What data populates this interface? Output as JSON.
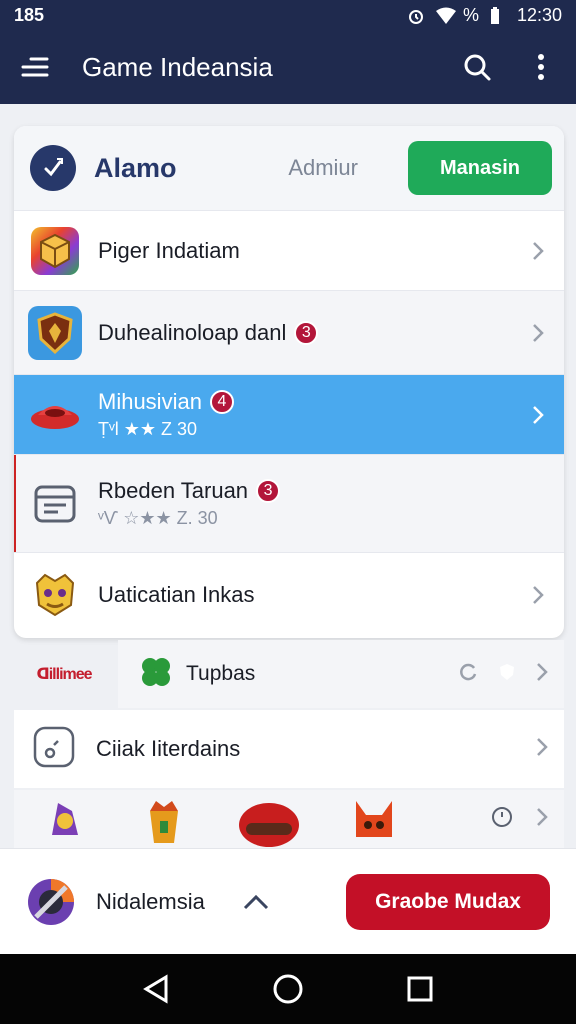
{
  "status": {
    "left": "185",
    "battery": "%",
    "time": "12:30"
  },
  "appbar": {
    "title": "Game Indeansia"
  },
  "card": {
    "name": "Alamo",
    "admin_label": "Admiur",
    "manage_label": "Manasin"
  },
  "rows": [
    {
      "label": "Piger Indatiam"
    },
    {
      "label": "Duhealinoloap danl",
      "badge": "3"
    },
    {
      "label": "Mihusivian",
      "badge": "4",
      "sub": "Ṭ‎ᵛl ★★ Z 30"
    },
    {
      "label": "Rbeden Taruan",
      "badge": "3",
      "sub": "ᵛ‎Ѵ ☆★★ Z. 30"
    },
    {
      "label": "Uaticatian Inkas"
    }
  ],
  "strip": {
    "brand_text": "ꓷillimee",
    "label": "Tupbas"
  },
  "single": {
    "label": "Ciiak Iiterdains"
  },
  "bottom": {
    "brand": "Nidalemsia",
    "cta": "Graobe Mudax"
  },
  "colors": {
    "appbar": "#1f2a4e",
    "active_row": "#4aa9ee",
    "manage": "#1faa59",
    "cta": "#c31027",
    "badge": "#b3163a"
  }
}
